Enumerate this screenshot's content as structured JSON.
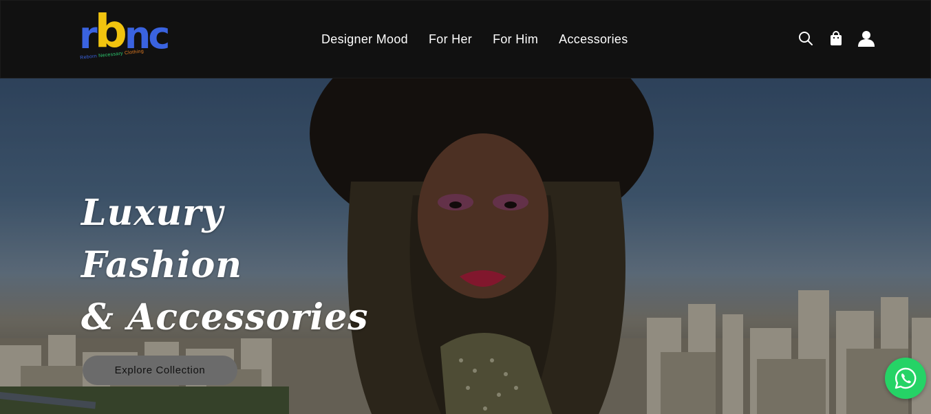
{
  "header": {
    "logo": {
      "mark_letters": [
        "r",
        "b",
        "n",
        "c"
      ],
      "tagline_parts": [
        "Reborn",
        "Necessary",
        "Clothing"
      ]
    },
    "nav": [
      {
        "label": "Designer Mood"
      },
      {
        "label": "For Her"
      },
      {
        "label": "For Him"
      },
      {
        "label": "Accessories"
      }
    ],
    "icons": [
      "search-icon",
      "shopping-bag-icon",
      "account-icon"
    ]
  },
  "hero": {
    "title_lines": [
      "Luxury",
      "Fashion",
      "& Accessories"
    ],
    "cta_label": "Explore Collection"
  },
  "floating": {
    "icon": "whatsapp-icon",
    "color": "#25d366"
  },
  "colors": {
    "header_bg": "#111111",
    "logo_blue": "#3a63e0",
    "logo_yellow": "#f1c40f",
    "cta_bg": "#6b6b6b"
  }
}
